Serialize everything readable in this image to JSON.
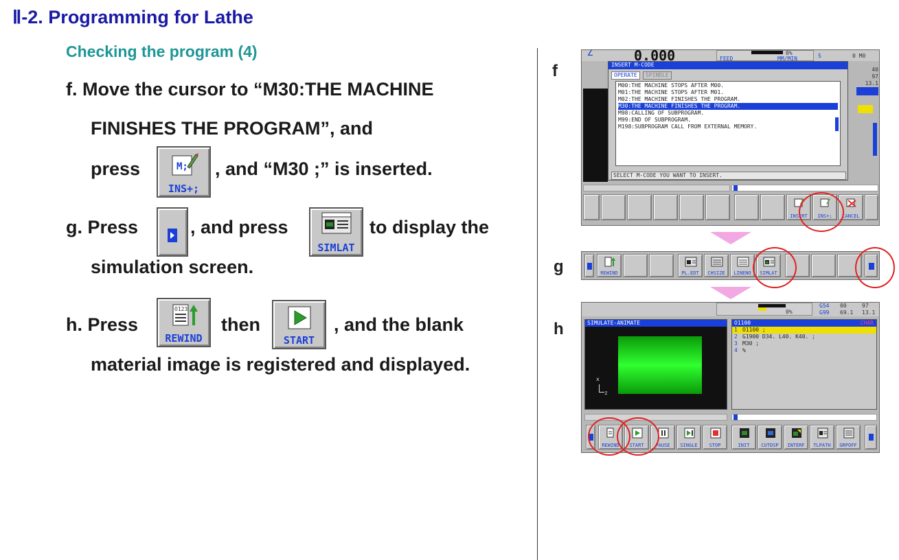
{
  "page": {
    "title": "Ⅱ-2. Programming for Lathe",
    "subtitle": "Checking the program  (4)"
  },
  "steps": {
    "f": {
      "line1": "f.  Move the cursor to “M30:THE MACHINE",
      "line2": "FINISHES THE PROGRAM”, and",
      "press": "press",
      "after": ", and “M30 ;” is inserted.",
      "button_label": "INS+;"
    },
    "g": {
      "press": "g. Press",
      "mid": ", and press",
      "after": "to display the",
      "line2": "simulation screen.",
      "button_label": "SIMLAT"
    },
    "h": {
      "press": "h. Press",
      "mid": "then",
      "after": ", and the blank",
      "line2": "material image is registered and displayed.",
      "rewind_label": "REWIND",
      "start_label": "START"
    }
  },
  "figure_letters": {
    "f": "f",
    "g": "g",
    "h": "h"
  },
  "screen_f": {
    "top_value": "0.000",
    "top_right": "0 M0",
    "feed": "FEED",
    "mmin": "MM/MIN",
    "s_label": "S",
    "pct": "0%",
    "side_values": [
      "40",
      "97",
      "13.1"
    ],
    "dialog_title": "INSERT M-CODE",
    "tabs": [
      "OPERATE",
      "SPINDLE"
    ],
    "mcodes": [
      "M00:THE MACHINE STOPS AFTER M00.",
      "M01:THE MACHINE STOPS AFTER M01.",
      "M02:THE MACHINE FINISHES THE PROGRAM.",
      "M30:THE MACHINE FINISHES THE PROGRAM.",
      "M98:CALLING OF SUBPROGRAM.",
      "M99:END OF SUBPROGRAM.",
      "M198:SUBPROGRAM CALL FROM EXTERNAL MEMORY."
    ],
    "selected_index": 3,
    "prompt": "SELECT M-CODE YOU WANT TO INSERT.",
    "softkeys": [
      "INSERT",
      "INS+;",
      "CANCEL"
    ]
  },
  "screen_g": {
    "softkeys": [
      "REWIND",
      "PL.EDT",
      "CHSIZE",
      "LINENO",
      "SIMLAT"
    ]
  },
  "screen_h": {
    "top_values": [
      "G54",
      "G99",
      "00",
      "69.1",
      "97",
      "13.1"
    ],
    "pct": "0%",
    "panel_title": "SIMULATE-ANIMATE",
    "prog_name": "O1100",
    "char_mode": "CHAR",
    "program_lines": [
      {
        "n": "1",
        "text": "O1100 ;"
      },
      {
        "n": "2",
        "text": "G1900 D34. L40. K40. ;"
      },
      {
        "n": "3",
        "text": "M30 ;"
      },
      {
        "n": "4",
        "text": "%"
      }
    ],
    "axis_x": "x",
    "axis_z": "z",
    "softkeys": [
      "REWIND",
      "START",
      "PAUSE",
      "SINGLE",
      "STOP",
      "INIT",
      "CUTDSP",
      "INTERF",
      "TLPATH",
      "GRPOFF"
    ]
  }
}
